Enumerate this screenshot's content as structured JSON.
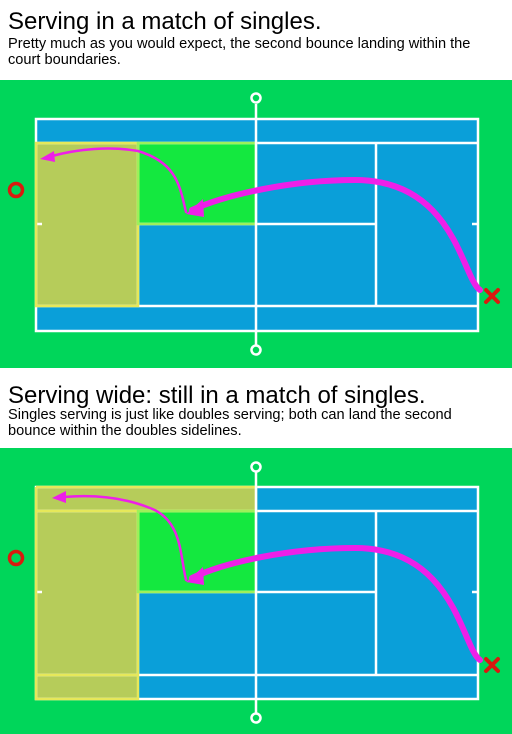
{
  "panels": [
    {
      "title": "Serving in a match of singles.",
      "description": "Pretty much as you would expect, the second bounce landing within the court boundaries."
    },
    {
      "title": "Serving wide: still in a match of singles.",
      "description": "Singles serving is just like doubles serving; both can land the second bounce within the doubles sidelines."
    }
  ],
  "colors": {
    "background": "#00d65a",
    "court": "#0a9fd9",
    "lines": "#ffffff",
    "landing_zone": "#b6cc5a",
    "landing_zone_border": "#e6e85a",
    "service_box_highlight": "#14e83f",
    "service_box_border": "#9ef05a",
    "arrow": "#ee1fe8",
    "receiver_marker": "#d91a0f",
    "server_marker": "#d91a0f"
  },
  "icons": {
    "receiver": "circle-marker-icon",
    "server": "x-marker-icon",
    "net_post": "net-post-icon"
  }
}
